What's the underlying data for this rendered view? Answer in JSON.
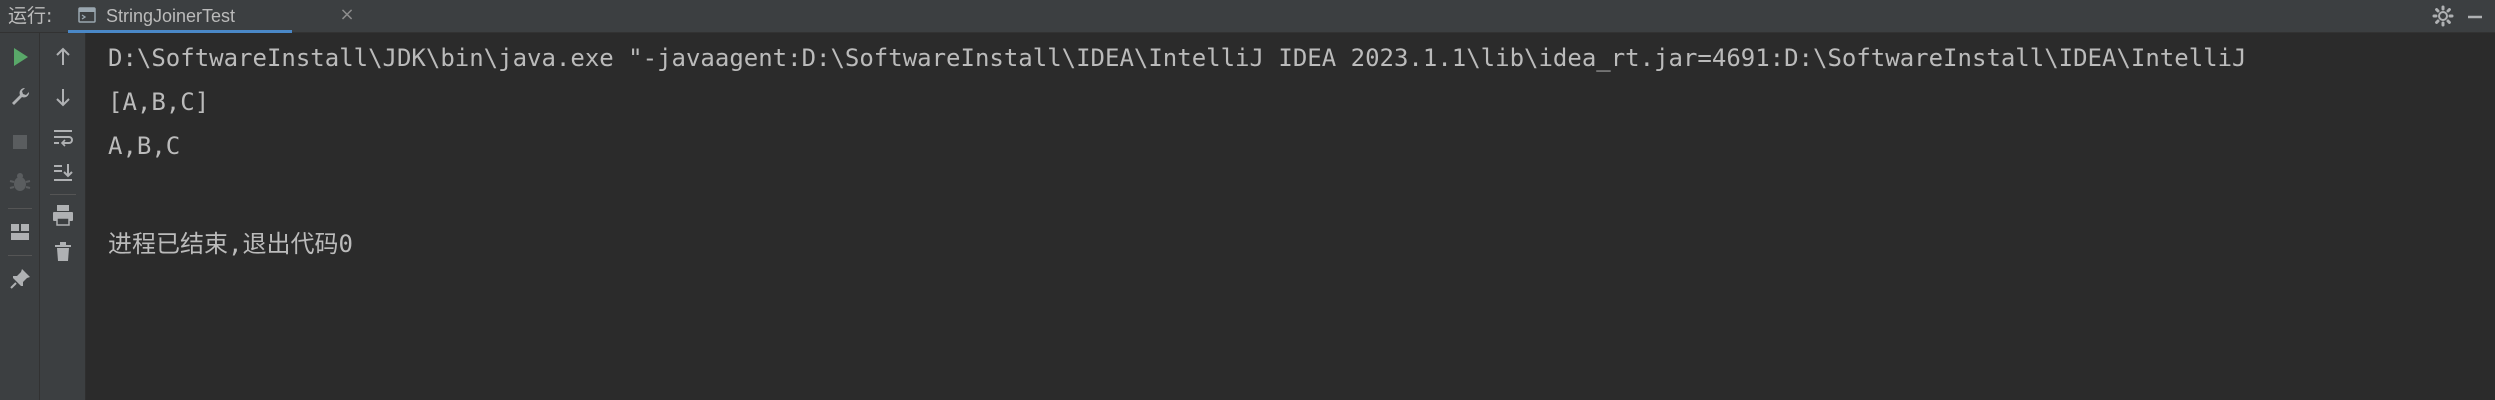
{
  "header": {
    "run_label": "运行:",
    "tab": {
      "label": "StringJoinerTest",
      "close_glyph": "×",
      "icon": "run-config-icon"
    },
    "actions": [
      "settings-icon",
      "minimize-icon"
    ]
  },
  "toolbar_left": [
    "rerun-icon",
    "wrench-icon",
    "stop-icon",
    "debug-icon",
    "layout-icon",
    "pin-icon"
  ],
  "toolbar_second": [
    "scroll-up-icon",
    "scroll-down-icon",
    "soft-wrap-icon",
    "scroll-to-end-icon",
    "print-icon",
    "trash-icon"
  ],
  "console": {
    "lines": [
      "D:\\SoftwareInstall\\JDK\\bin\\java.exe \"-javaagent:D:\\SoftwareInstall\\IDEA\\IntelliJ IDEA 2023.1.1\\lib\\idea_rt.jar=4691:D:\\SoftwareInstall\\IDEA\\IntelliJ",
      "[A,B,C]",
      "A,B,C",
      "",
      "进程已结束,退出代码0"
    ]
  },
  "colors": {
    "background": "#2b2b2b",
    "toolbar": "#3c3f41",
    "text": "#bbbbbb",
    "run_green": "#59a869",
    "tab_underline": "#4a88c7"
  }
}
